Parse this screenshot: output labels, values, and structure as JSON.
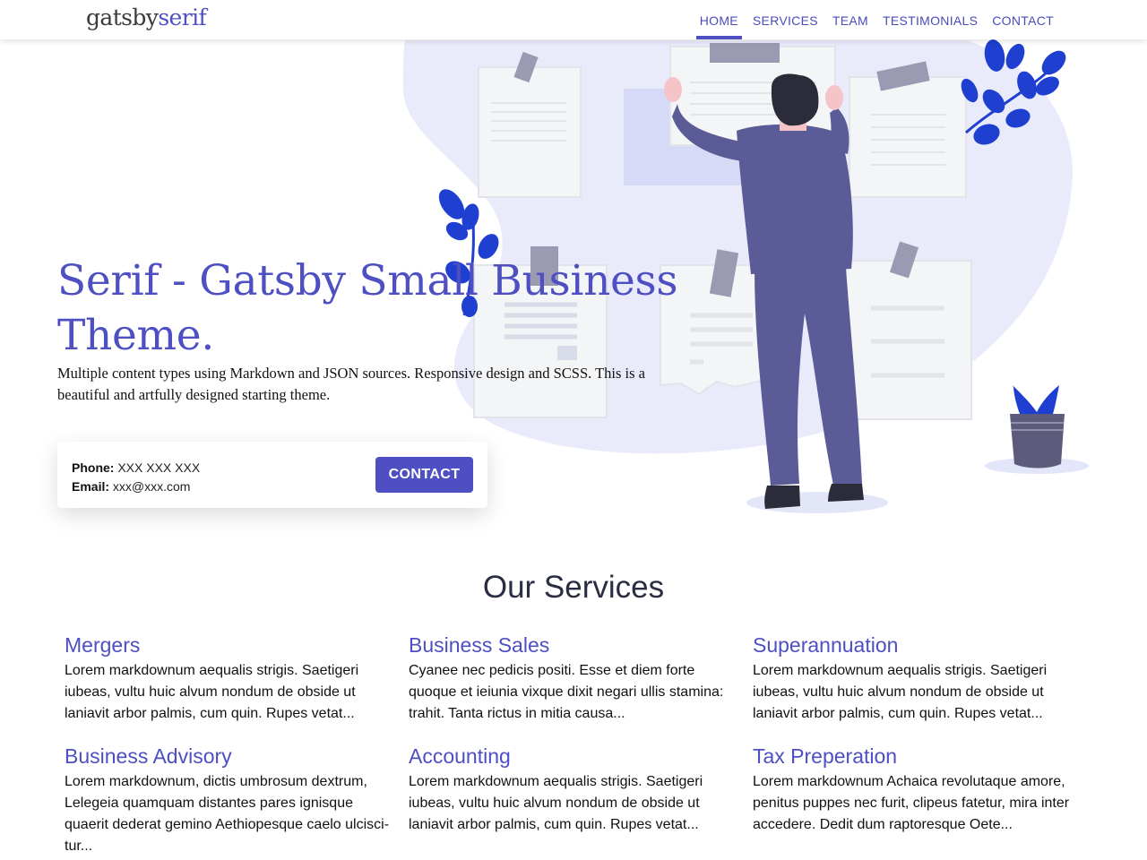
{
  "header": {
    "logo_part1": "gatsby",
    "logo_part2": "serif",
    "nav": [
      "HOME",
      "SERVICES",
      "TEAM",
      "TESTIMONIALS",
      "CONTACT"
    ],
    "active_nav": "HOME"
  },
  "hero": {
    "title": "Serif - Gatsby Small Business Theme.",
    "description": "Multiple content types using Markdown and JSON sources. Responsive design and SCSS. This is a beautiful and artfully designed starting theme.",
    "phone_label": "Phone:",
    "phone_value": "XXX XXX XXX",
    "email_label": "Email:",
    "email_value": "xxx@xxx.com",
    "contact_button": "CONTACT"
  },
  "services": {
    "heading": "Our Services",
    "items": [
      {
        "title": "Mergers",
        "text": "Lorem markdownum aequalis strigis. Saetigeri iubeas, vultu huic alvum nondum de obside ut laniavit arbor palmis, cum quin. Rupes vetat..."
      },
      {
        "title": "Business Sales",
        "text": "Cyanee nec pedicis positi. Esse et diem forte quoque et ieiunia vixque dixit negari ullis stamina: trahit. Tanta rictus in mitia causa..."
      },
      {
        "title": "Superannuation",
        "text": "Lorem markdownum aequalis strigis. Saetigeri iubeas, vultu huic alvum nondum de obside ut laniavit arbor palmis, cum quin. Rupes vetat..."
      },
      {
        "title": "Business Advisory",
        "text": "Lorem markdownum, dictis umbrosum dextrum, Lelegeia quamquam distantes pares ignisque quaerit dederat gemino Aethiopesque caelo ulcisci­tur..."
      },
      {
        "title": "Accounting",
        "text": "Lorem markdownum aequalis strigis. Saetigeri iubeas, vultu huic alvum nondum de obside ut laniavit arbor palmis, cum quin. Rupes vetat..."
      },
      {
        "title": "Tax Preperation",
        "text": "Lorem markdownum Achaica revolutaque amore, penitus puppes nec furit, clipeus fatetur, mira inter accedere. Dedit dum raptoresque Oete..."
      }
    ]
  },
  "colors": {
    "brand": "#4d4fc2",
    "blob": "#e9ebfb",
    "suit": "#5b5b97",
    "leaf": "#1f3fd0"
  }
}
